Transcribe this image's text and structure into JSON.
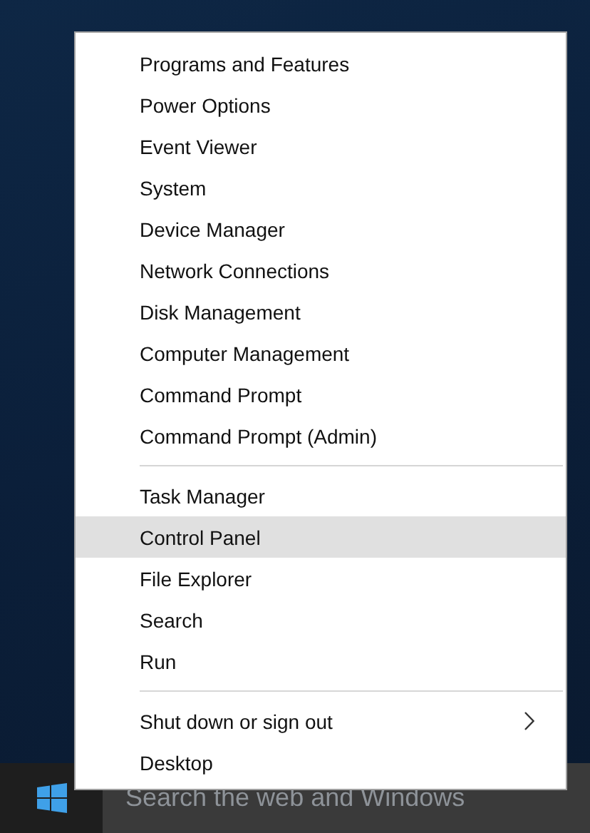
{
  "menu": {
    "groups": [
      [
        {
          "label": "Programs and Features",
          "selected": false,
          "has_submenu": false
        },
        {
          "label": "Power Options",
          "selected": false,
          "has_submenu": false
        },
        {
          "label": "Event Viewer",
          "selected": false,
          "has_submenu": false
        },
        {
          "label": "System",
          "selected": false,
          "has_submenu": false
        },
        {
          "label": "Device Manager",
          "selected": false,
          "has_submenu": false
        },
        {
          "label": "Network Connections",
          "selected": false,
          "has_submenu": false
        },
        {
          "label": "Disk Management",
          "selected": false,
          "has_submenu": false
        },
        {
          "label": "Computer Management",
          "selected": false,
          "has_submenu": false
        },
        {
          "label": "Command Prompt",
          "selected": false,
          "has_submenu": false
        },
        {
          "label": "Command Prompt (Admin)",
          "selected": false,
          "has_submenu": false
        }
      ],
      [
        {
          "label": "Task Manager",
          "selected": false,
          "has_submenu": false
        },
        {
          "label": "Control Panel",
          "selected": true,
          "has_submenu": false
        },
        {
          "label": "File Explorer",
          "selected": false,
          "has_submenu": false
        },
        {
          "label": "Search",
          "selected": false,
          "has_submenu": false
        },
        {
          "label": "Run",
          "selected": false,
          "has_submenu": false
        }
      ],
      [
        {
          "label": "Shut down or sign out",
          "selected": false,
          "has_submenu": true
        },
        {
          "label": "Desktop",
          "selected": false,
          "has_submenu": false
        }
      ]
    ]
  },
  "taskbar": {
    "search": {
      "placeholder": "Search the web and Windows"
    }
  }
}
